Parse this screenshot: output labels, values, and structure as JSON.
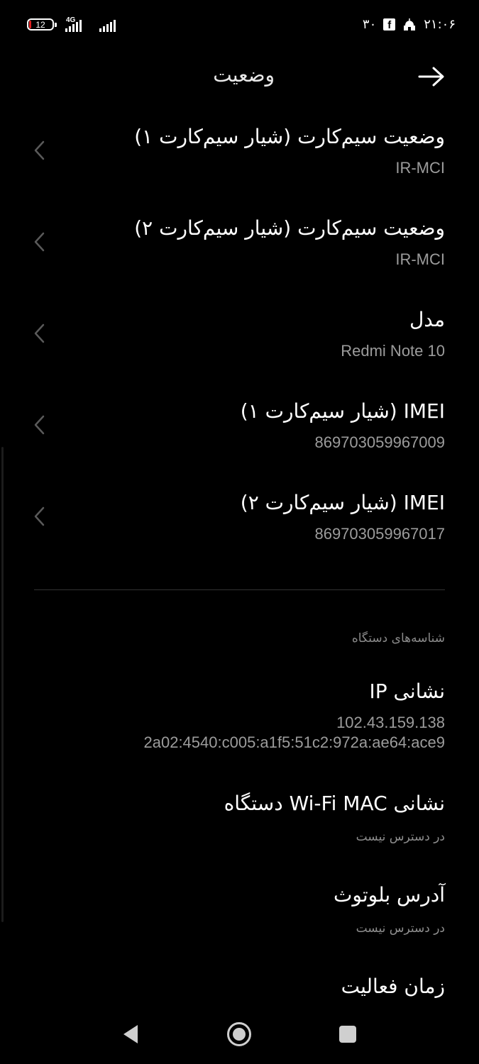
{
  "status_bar": {
    "battery": "12",
    "network_type": "4G",
    "time": "۲۱:۰۶",
    "notification_count": "۳۰",
    "icons": [
      "battery-icon",
      "signal-icon",
      "facebook-icon",
      "mosque-icon"
    ]
  },
  "header": {
    "title": "وضعیت",
    "back_icon": "arrow-right-icon"
  },
  "items": [
    {
      "title": "وضعیت سیم‌کارت (شیار سیم‌کارت ۱)",
      "value": "IR-MCI"
    },
    {
      "title": "وضعیت سیم‌کارت (شیار سیم‌کارت ۲)",
      "value": "IR-MCI"
    },
    {
      "title": "مدل",
      "value": "Redmi Note 10"
    },
    {
      "title": "IMEI (شیار سیم‌کارت ۱)",
      "value": "869703059967009"
    },
    {
      "title": "IMEI (شیار سیم‌کارت ۲)",
      "value": "869703059967017"
    }
  ],
  "section": {
    "title": "شناسه‌های دستگاه"
  },
  "identifiers": [
    {
      "title": "نشانی IP",
      "value_line1": "102.43.159.138",
      "value_line2": "2a02:4540:c005:a1f5:51c2:972a:ae64:ace9"
    },
    {
      "title": "نشانی Wi-Fi MAC دستگاه",
      "value": "در دسترس نیست"
    },
    {
      "title": "آدرس بلوتوث",
      "value": "در دسترس نیست"
    },
    {
      "title": "زمان فعالیت"
    }
  ],
  "nav_bar": {
    "buttons": [
      "back-triangle-icon",
      "home-circle-icon",
      "recents-square-icon"
    ]
  },
  "colors": {
    "background": "#000000",
    "text_primary": "#ffffff",
    "text_secondary": "#9c9c9c",
    "divider": "#333333"
  }
}
